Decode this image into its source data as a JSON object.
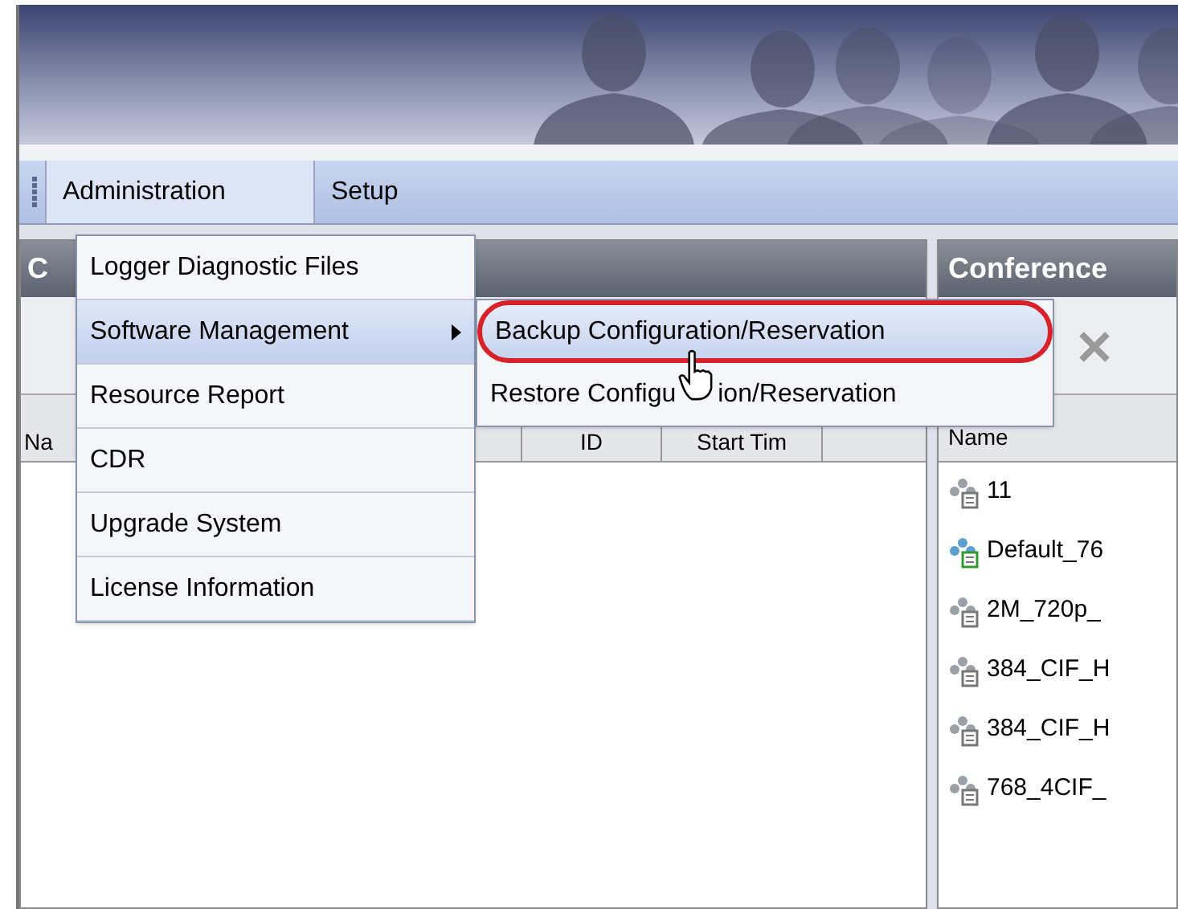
{
  "menu_bar": [
    {
      "label": "Administration",
      "selected": true
    },
    {
      "label": "Setup",
      "selected": false
    }
  ],
  "admin_menu": [
    {
      "label": "Logger Diagnostic Files",
      "selected": false,
      "submenu": false
    },
    {
      "label": "Software Management",
      "selected": true,
      "submenu": true
    },
    {
      "label": "Resource Report",
      "selected": false,
      "submenu": false
    },
    {
      "label": "CDR",
      "selected": false,
      "submenu": false
    },
    {
      "label": "Upgrade System",
      "selected": false,
      "submenu": false
    },
    {
      "label": "License Information",
      "selected": false,
      "submenu": false
    }
  ],
  "software_submenu": [
    {
      "label": "Backup Configuration/Reservation",
      "selected": true
    },
    {
      "label": "Restore Configu",
      "label_after_cursor": "ion/Reservation",
      "selected": false
    }
  ],
  "left_panel": {
    "title": "C",
    "columns": [
      "Na",
      "ID",
      "Start Tim"
    ]
  },
  "right_panel": {
    "title": "Conference",
    "columns": [
      "Name"
    ],
    "rows": [
      {
        "name": "11",
        "active": false
      },
      {
        "name": "Default_76",
        "active": true
      },
      {
        "name": "2M_720p_",
        "active": false
      },
      {
        "name": "384_CIF_H",
        "active": false
      },
      {
        "name": "384_CIF_H",
        "active": false
      },
      {
        "name": "768_4CIF_",
        "active": false
      }
    ]
  }
}
